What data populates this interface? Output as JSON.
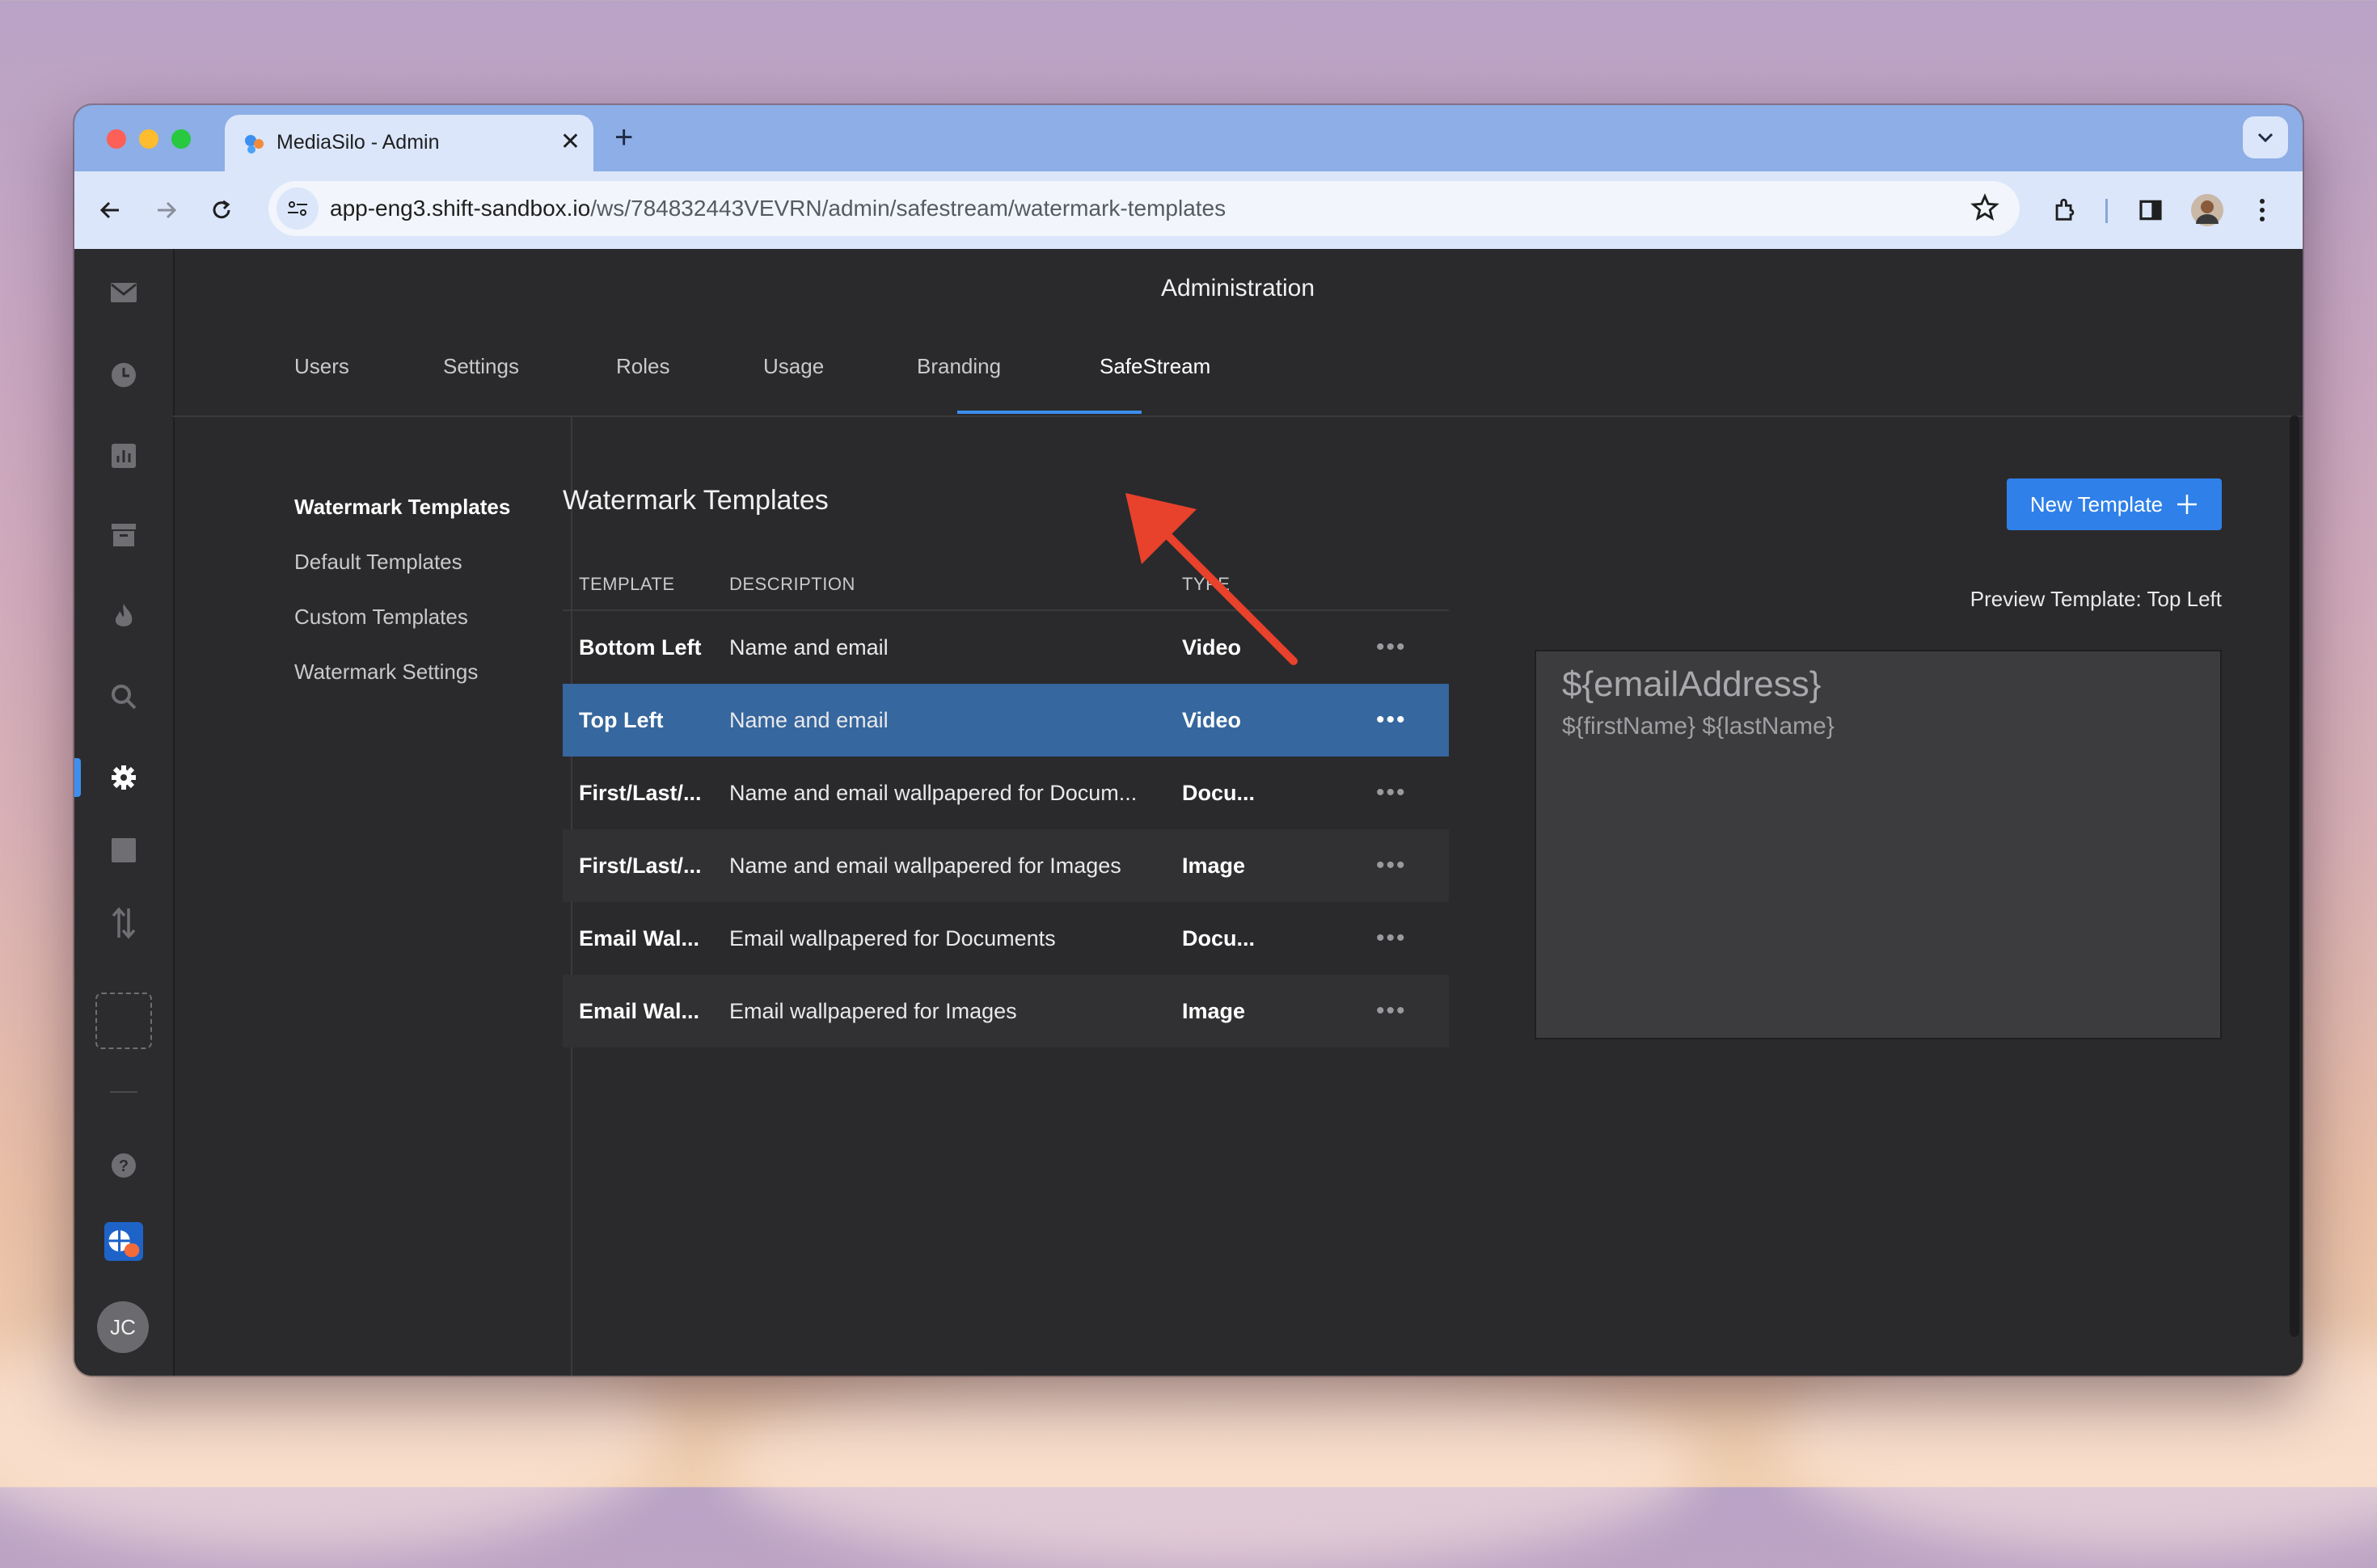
{
  "browser": {
    "tab_title": "MediaSilo - Admin",
    "url_host": "app-eng3.shift-sandbox.io",
    "url_path": "/ws/784832443VEVRN/admin/safestream/watermark-templates",
    "colors": {
      "tabbar": "#8daee6",
      "toolbar": "#dbe6fb"
    }
  },
  "app": {
    "header_title": "Administration",
    "tabs": [
      {
        "label": "Users"
      },
      {
        "label": "Settings"
      },
      {
        "label": "Roles"
      },
      {
        "label": "Usage"
      },
      {
        "label": "Branding"
      },
      {
        "label": "SafeStream",
        "active": true
      }
    ],
    "subnav": [
      {
        "label": "Watermark Templates",
        "active": true
      },
      {
        "label": "Default Templates"
      },
      {
        "label": "Custom Templates"
      },
      {
        "label": "Watermark Settings"
      }
    ],
    "section_title": "Watermark Templates",
    "new_template_label": "New Template",
    "table": {
      "columns": [
        "TEMPLATE",
        "DESCRIPTION",
        "TYPE"
      ],
      "rows": [
        {
          "template": "Bottom Left",
          "description": "Name and email",
          "type": "Video",
          "selected": false
        },
        {
          "template": "Top Left",
          "description": "Name and email",
          "type": "Video",
          "selected": true
        },
        {
          "template": "First/Last/...",
          "description": "Name and email wallpapered for Docum...",
          "type": "Docu...",
          "selected": false
        },
        {
          "template": "First/Last/...",
          "description": "Name and email wallpapered for Images",
          "type": "Image",
          "selected": false
        },
        {
          "template": "Email Wal...",
          "description": "Email wallpapered for Documents",
          "type": "Docu...",
          "selected": false
        },
        {
          "template": "Email Wal...",
          "description": "Email wallpapered for Images",
          "type": "Image",
          "selected": false
        }
      ],
      "row_menu": "•••"
    },
    "preview": {
      "label": "Preview Template: Top Left",
      "line1": "${emailAddress}",
      "line2": "${firstName} ${lastName}"
    },
    "user_initials": "JC",
    "accent_color": "#2f80e8"
  },
  "annotation": {
    "type": "arrow",
    "color": "#e8412c",
    "target": "SafeStream tab"
  }
}
